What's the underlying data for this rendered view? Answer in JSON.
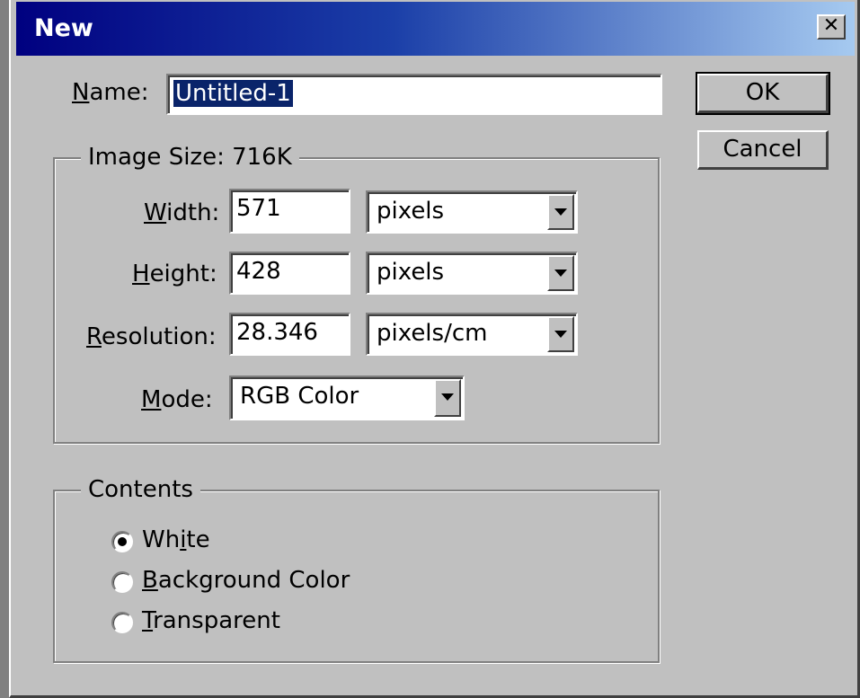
{
  "window": {
    "title": "New",
    "close_symbol": "✕"
  },
  "name_field": {
    "label_first": "N",
    "label_rest": "ame:",
    "value": "Untitled-1"
  },
  "image_size": {
    "legend": "Image Size:  716K",
    "width": {
      "label_first": "W",
      "label_rest": "idth:",
      "value": "571",
      "unit": "pixels"
    },
    "height": {
      "label_first": "H",
      "label_rest": "eight:",
      "value": "428",
      "unit": "pixels"
    },
    "resolution": {
      "label_first": "R",
      "label_rest": "esolution:",
      "value": "28.346",
      "unit": "pixels/cm"
    },
    "mode": {
      "label_first": "M",
      "label_rest": "ode:",
      "value": "RGB Color"
    }
  },
  "contents": {
    "legend": "Contents",
    "options": [
      {
        "label_pre": "Wh",
        "label_ul": "i",
        "label_post": "te",
        "checked": true
      },
      {
        "label_pre": "",
        "label_ul": "B",
        "label_post": "ackground Color",
        "checked": false
      },
      {
        "label_pre": "",
        "label_ul": "T",
        "label_post": "ransparent",
        "checked": false
      }
    ]
  },
  "buttons": {
    "ok_label": "OK",
    "cancel_label": "Cancel"
  },
  "icons": {
    "close": "close-icon",
    "dropdown": "chevron-down-icon",
    "radio": "radio-button-icon"
  },
  "colors": {
    "face": "#c0c0c0",
    "title_start": "#000080",
    "title_end": "#a6caf0",
    "selection": "#0a246a"
  }
}
